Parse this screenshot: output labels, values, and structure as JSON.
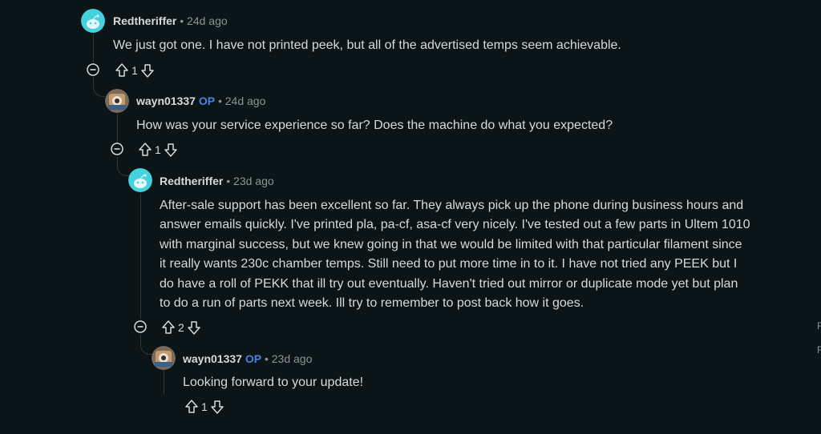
{
  "comments": [
    {
      "author": "Redtheriffer",
      "op_badge": "",
      "separator": "•",
      "time": "24d ago",
      "body": "We just got one. I have not printed peek, but all of the advertised temps seem achievable.",
      "score": "1",
      "avatar_icon": "snoo-avatar-icon"
    },
    {
      "author": "wayn01337",
      "op_badge": "OP",
      "separator": "•",
      "time": "24d ago",
      "body": "How was your service experience so far? Does the machine do what you expected?",
      "score": "1",
      "avatar_icon": "user-avatar-icon"
    },
    {
      "author": "Redtheriffer",
      "op_badge": "",
      "separator": "•",
      "time": "23d ago",
      "body_lines": [
        "After-sale support has been excellent so far. They always pick up the phone during business hours and",
        "answer emails quickly. I've printed pla, pa-cf, asa-cf very nicely. I've tested out a few parts in Ultem 1010",
        "with marginal success, but we knew going in that we would be limited with that particular filament since",
        "it really wants 230c chamber temps. Still need to put more time in to it. I have not tried any PEEK but I",
        "do have a roll of PEKK that ill try out eventually. Haven't tried out mirror or duplicate mode yet but plan",
        "to do a run of parts next week. Ill try to remember to post back how it goes."
      ],
      "score": "2",
      "avatar_icon": "snoo-avatar-icon"
    },
    {
      "author": "wayn01337",
      "op_badge": "OP",
      "separator": "•",
      "time": "23d ago",
      "body": "Looking forward to your update!",
      "score": "1",
      "avatar_icon": "user-avatar-icon"
    }
  ],
  "edge_glyphs": [
    "F",
    "F"
  ],
  "colors": {
    "background": "#0b1416",
    "text": "#d7dadc",
    "muted": "#8b9597",
    "op": "#4a83e0",
    "thread_line": "#343536",
    "snoo_bg": "#46d1df"
  }
}
